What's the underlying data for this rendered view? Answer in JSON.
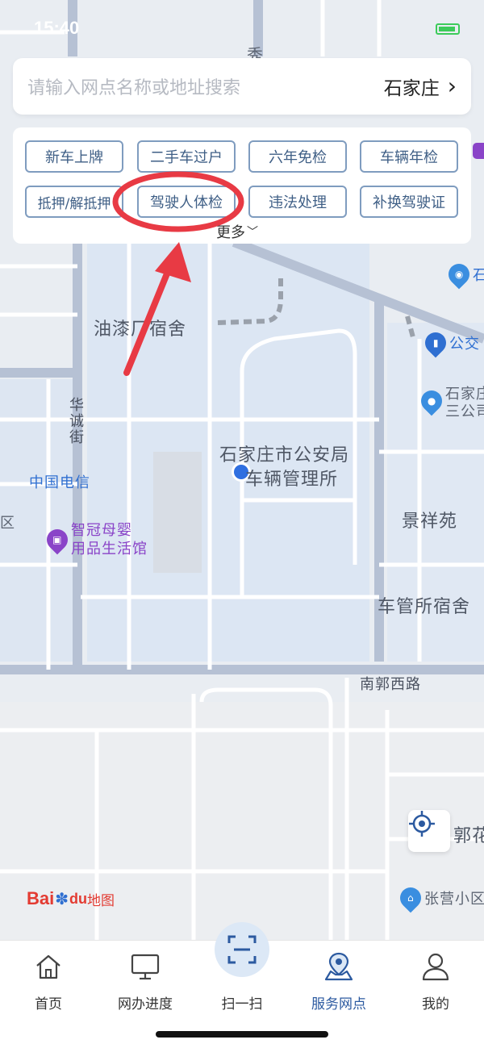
{
  "status_bar": {
    "time": "15:40"
  },
  "search": {
    "placeholder": "请输入网点名称或地址搜索",
    "city": "石家庄"
  },
  "services": {
    "row1": [
      "新车上牌",
      "二手车过户",
      "六年免检",
      "车辆年检"
    ],
    "row2": [
      "抵押/解抵押",
      "驾驶人体检",
      "违法处理",
      "补换驾驶证"
    ],
    "more_label": "更多"
  },
  "map": {
    "labels": {
      "xiu": "秀",
      "youqi": "油漆厂宿舍",
      "huacheng": "华诚街",
      "telecom": "中国电信",
      "muying_1": "智冠母婴",
      "muying_2": "用品生活馆",
      "police_1": "石家庄市公安局",
      "police_2": "车辆管理所",
      "jingxiang": "景祥苑",
      "cheguan": "车管所宿舍",
      "nanguo": "南郭西路",
      "shi_edge": "石",
      "gongjiao": "公交",
      "sanmu_1": "石家庄",
      "sanmu_2": "三公司",
      "qu": "区",
      "guohua": "郭花",
      "zhangying": "张营小区"
    },
    "logo_text": [
      "Bai",
      "du",
      "地图"
    ]
  },
  "tabs": [
    {
      "label": "首页",
      "icon": "home-icon"
    },
    {
      "label": "网办进度",
      "icon": "monitor-icon"
    },
    {
      "label": "扫一扫",
      "icon": "scan-icon"
    },
    {
      "label": "服务网点",
      "icon": "map-location-icon"
    },
    {
      "label": "我的",
      "icon": "user-icon"
    }
  ],
  "colors": {
    "accent": "#2c5aa0",
    "button_border": "#7f9cbf",
    "annotation": "#e83a44",
    "location_dot": "#2f6fe0"
  }
}
